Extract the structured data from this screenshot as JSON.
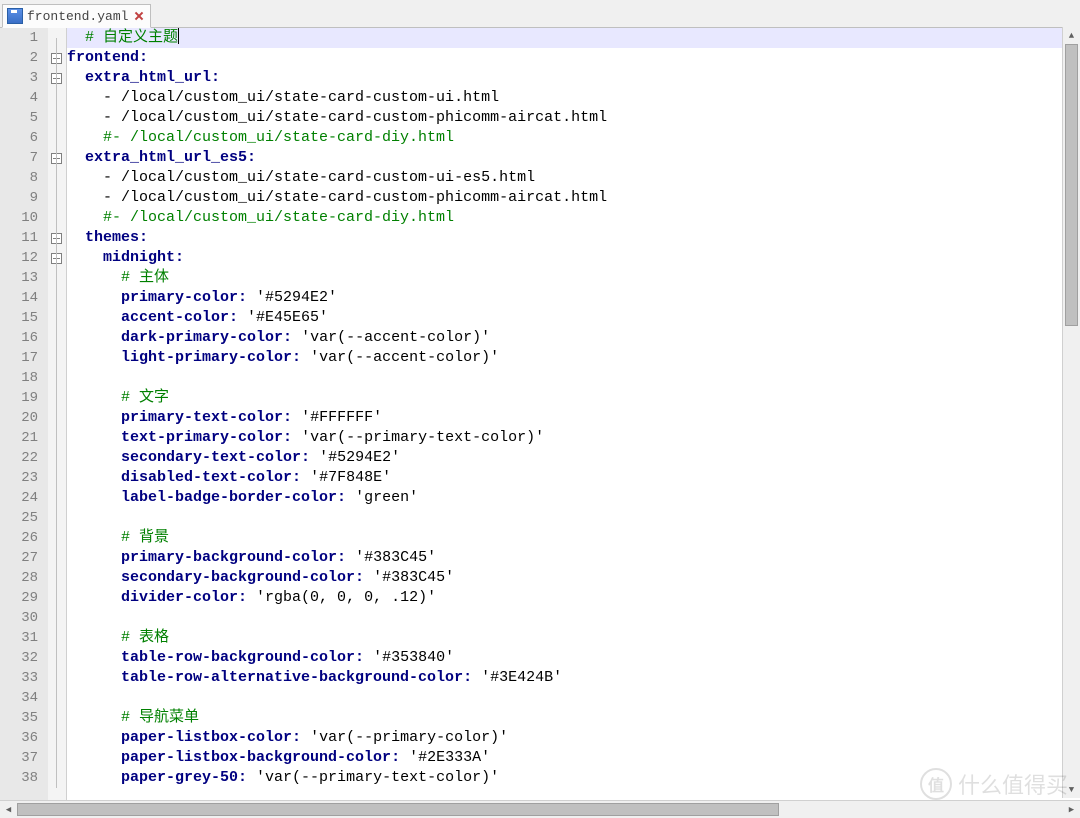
{
  "tab": {
    "filename": "frontend.yaml"
  },
  "lines": [
    {
      "n": 1,
      "indent": 1,
      "type": "comment",
      "text": "# 自定义主题",
      "current": true
    },
    {
      "n": 2,
      "indent": 0,
      "type": "key",
      "key": "frontend",
      "fold": true
    },
    {
      "n": 3,
      "indent": 1,
      "type": "key",
      "key": "extra_html_url",
      "fold": true
    },
    {
      "n": 4,
      "indent": 2,
      "type": "item",
      "text": "- /local/custom_ui/state-card-custom-ui.html"
    },
    {
      "n": 5,
      "indent": 2,
      "type": "item",
      "text": "- /local/custom_ui/state-card-custom-phicomm-aircat.html"
    },
    {
      "n": 6,
      "indent": 2,
      "type": "comment",
      "text": "#- /local/custom_ui/state-card-diy.html"
    },
    {
      "n": 7,
      "indent": 1,
      "type": "key",
      "key": "extra_html_url_es5",
      "fold": true
    },
    {
      "n": 8,
      "indent": 2,
      "type": "item",
      "text": "- /local/custom_ui/state-card-custom-ui-es5.html"
    },
    {
      "n": 9,
      "indent": 2,
      "type": "item",
      "text": "- /local/custom_ui/state-card-custom-phicomm-aircat.html"
    },
    {
      "n": 10,
      "indent": 2,
      "type": "comment",
      "text": "#- /local/custom_ui/state-card-diy.html"
    },
    {
      "n": 11,
      "indent": 1,
      "type": "key",
      "key": "themes",
      "fold": true
    },
    {
      "n": 12,
      "indent": 2,
      "type": "key",
      "key": "midnight",
      "fold": true
    },
    {
      "n": 13,
      "indent": 3,
      "type": "comment",
      "text": "# 主体"
    },
    {
      "n": 14,
      "indent": 3,
      "type": "kv",
      "key": "primary-color",
      "val": "'#5294E2'"
    },
    {
      "n": 15,
      "indent": 3,
      "type": "kv",
      "key": "accent-color",
      "val": "'#E45E65'"
    },
    {
      "n": 16,
      "indent": 3,
      "type": "kv",
      "key": "dark-primary-color",
      "val": "'var(--accent-color)'"
    },
    {
      "n": 17,
      "indent": 3,
      "type": "kv",
      "key": "light-primary-color",
      "val": "'var(--accent-color)'"
    },
    {
      "n": 18,
      "indent": 3,
      "type": "blank"
    },
    {
      "n": 19,
      "indent": 3,
      "type": "comment",
      "text": "# 文字"
    },
    {
      "n": 20,
      "indent": 3,
      "type": "kv",
      "key": "primary-text-color",
      "val": "'#FFFFFF'"
    },
    {
      "n": 21,
      "indent": 3,
      "type": "kv",
      "key": "text-primary-color",
      "val": "'var(--primary-text-color)'"
    },
    {
      "n": 22,
      "indent": 3,
      "type": "kv",
      "key": "secondary-text-color",
      "val": "'#5294E2'"
    },
    {
      "n": 23,
      "indent": 3,
      "type": "kv",
      "key": "disabled-text-color",
      "val": "'#7F848E'"
    },
    {
      "n": 24,
      "indent": 3,
      "type": "kv",
      "key": "label-badge-border-color",
      "val": "'green'"
    },
    {
      "n": 25,
      "indent": 3,
      "type": "blank"
    },
    {
      "n": 26,
      "indent": 3,
      "type": "comment",
      "text": "# 背景"
    },
    {
      "n": 27,
      "indent": 3,
      "type": "kv",
      "key": "primary-background-color",
      "val": "'#383C45'"
    },
    {
      "n": 28,
      "indent": 3,
      "type": "kv",
      "key": "secondary-background-color",
      "val": "'#383C45'"
    },
    {
      "n": 29,
      "indent": 3,
      "type": "kv",
      "key": "divider-color",
      "val": "'rgba(0, 0, 0, .12)'"
    },
    {
      "n": 30,
      "indent": 3,
      "type": "blank"
    },
    {
      "n": 31,
      "indent": 3,
      "type": "comment",
      "text": "# 表格"
    },
    {
      "n": 32,
      "indent": 3,
      "type": "kv",
      "key": "table-row-background-color",
      "val": "'#353840'"
    },
    {
      "n": 33,
      "indent": 3,
      "type": "kv",
      "key": "table-row-alternative-background-color",
      "val": "'#3E424B'"
    },
    {
      "n": 34,
      "indent": 3,
      "type": "blank"
    },
    {
      "n": 35,
      "indent": 3,
      "type": "comment",
      "text": "# 导航菜单"
    },
    {
      "n": 36,
      "indent": 3,
      "type": "kv",
      "key": "paper-listbox-color",
      "val": "'var(--primary-color)'"
    },
    {
      "n": 37,
      "indent": 3,
      "type": "kv",
      "key": "paper-listbox-background-color",
      "val": "'#2E333A'"
    },
    {
      "n": 38,
      "indent": 3,
      "type": "kv",
      "key": "paper-grey-50",
      "val": "'var(--primary-text-color)'"
    }
  ],
  "watermark": {
    "logo": "值",
    "text": "什么值得买"
  }
}
